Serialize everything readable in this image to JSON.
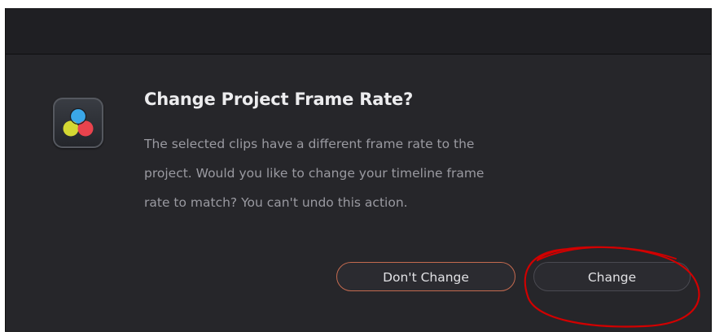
{
  "dialog": {
    "title": "Change Project Frame Rate?",
    "message_lines": [
      "The selected clips have a different frame rate to the",
      "project. Would you like to change your timeline frame",
      "rate to match? You can't undo this action."
    ],
    "app_icon": "davinci-resolve-icon"
  },
  "buttons": {
    "dont_change_label": "Don't Change",
    "change_label": "Change"
  },
  "colors": {
    "dialog_background": "#26262a",
    "title_bar": "#1f1f23",
    "title_text": "#ececee",
    "message_text": "#9a9aa1",
    "dont_change_border": "#c46a4f",
    "annotation_circle": "#d10000"
  }
}
